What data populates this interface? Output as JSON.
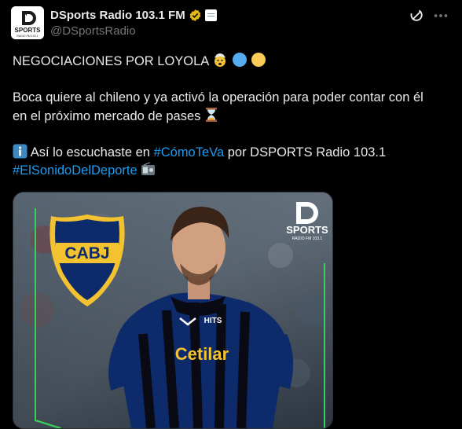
{
  "account": {
    "display_name": "DSports Radio 103.1 FM",
    "handle": "@DSportsRadio",
    "avatar_text": "SPORTS",
    "avatar_subtext": "RADIO FM 103.1"
  },
  "tweet": {
    "line1": "NEGOCIACIONES POR LOYOLA",
    "line2": "Boca quiere al chileno y ya activó la operación para poder contar con él",
    "line3": "en el próximo mercado de pases",
    "line4_prefix": "Así lo escuchaste en",
    "hashtag1": "#CómoTeVa",
    "line4_suffix": "por DSPORTS Radio 103.1",
    "hashtag2": "#ElSonidoDelDeporte"
  },
  "media": {
    "badge_text": "CABJ",
    "logo_text": "SPORTS",
    "logo_subtext": "RADIO FM 103.1",
    "shirt_sponsor": "Cetilar",
    "shirt_brand": "HITS"
  },
  "colors": {
    "background": "#000000",
    "text": "#e7e9ea",
    "secondary": "#71767b",
    "link": "#1d9bf0",
    "verified": "#e2b719",
    "boca_blue": "#0d2a6b",
    "boca_gold": "#f2c230",
    "frame_green": "#37d05a"
  },
  "icons": {
    "verified": "verified-badge-icon",
    "affiliate": "affiliate-badge-icon",
    "grok": "grok-icon",
    "more": "more-options-icon"
  }
}
